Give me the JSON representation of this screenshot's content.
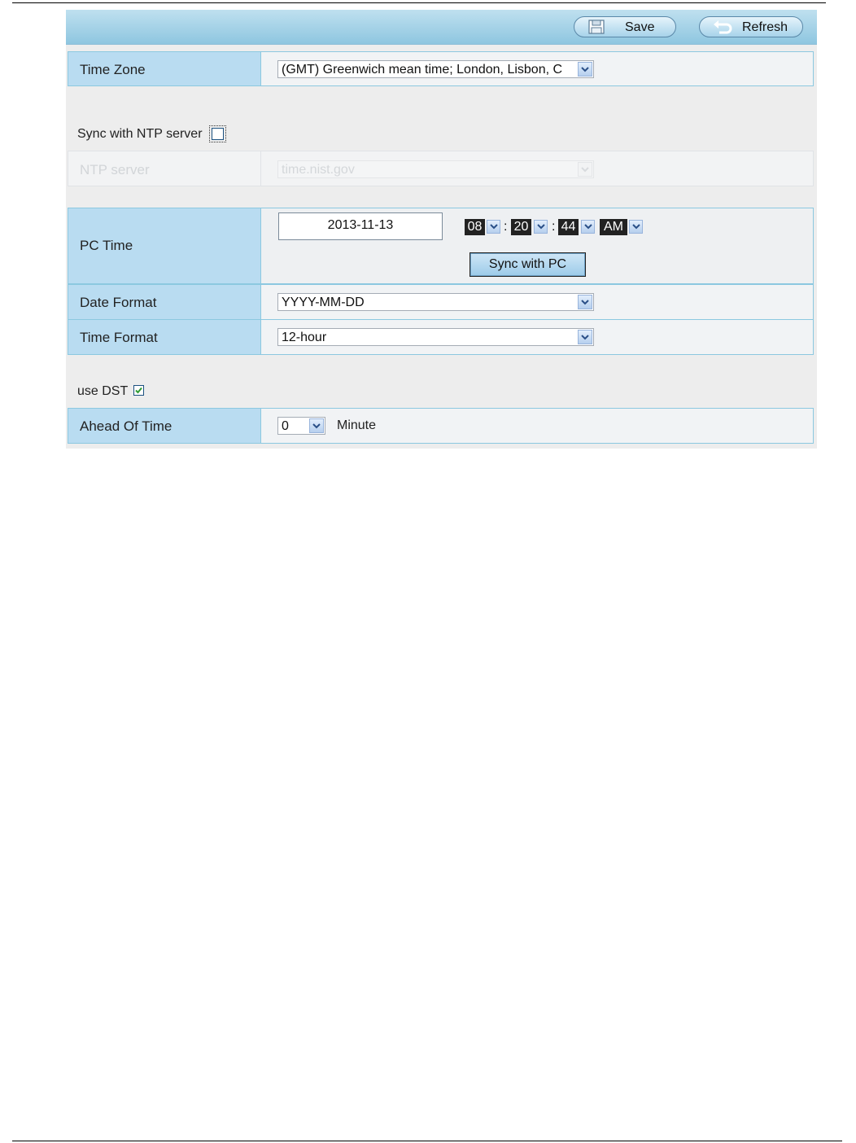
{
  "toolbar": {
    "save_label": "Save",
    "refresh_label": "Refresh"
  },
  "time_zone": {
    "label": "Time Zone",
    "value": "(GMT) Greenwich mean time; London, Lisbon, C"
  },
  "ntp": {
    "sync_label": "Sync with NTP server",
    "sync_checked": false,
    "server_label": "NTP server",
    "server_value": "time.nist.gov"
  },
  "pc_time": {
    "label": "PC Time",
    "date": "2013-11-13",
    "hour": "08",
    "minute": "20",
    "second": "44",
    "ampm": "AM",
    "separator": ":",
    "sync_button": "Sync with PC"
  },
  "date_format": {
    "label": "Date Format",
    "value": "YYYY-MM-DD"
  },
  "time_format": {
    "label": "Time Format",
    "value": "12-hour"
  },
  "dst": {
    "label": "use DST",
    "checked": true
  },
  "ahead_of_time": {
    "label": "Ahead Of Time",
    "value": "0",
    "unit": "Minute"
  },
  "colors": {
    "header": "#8ec6e0",
    "label_cell": "#b9dcf1",
    "border": "#8cc8e0",
    "check": "#2e9b32"
  }
}
